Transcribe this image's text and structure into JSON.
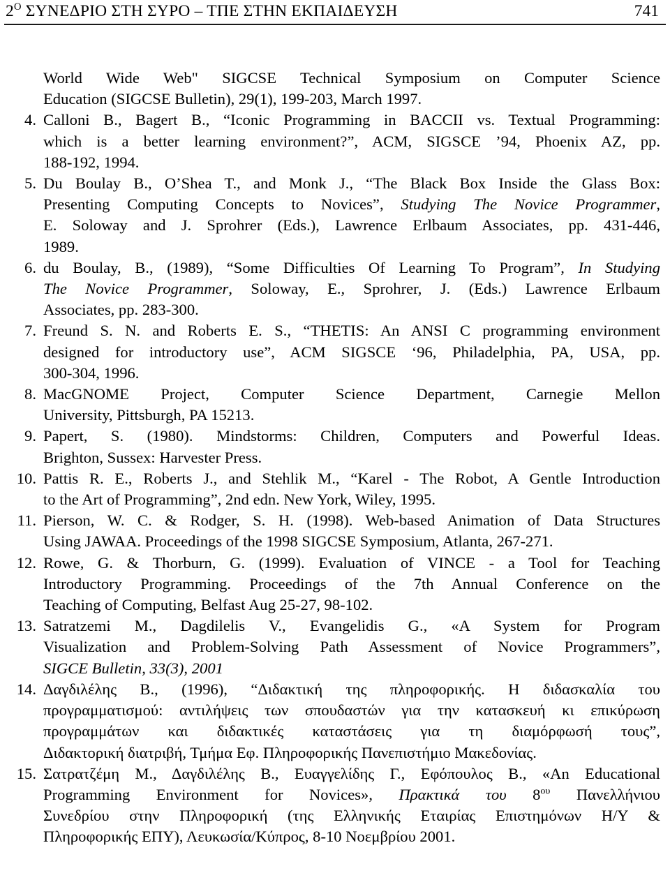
{
  "header": {
    "title_main": "2",
    "title_sup": "Ο",
    "title_rest": " ΣΥΝΕΔΡΙΟ ΣΤΗ ΣΥΡΟ – ΤΠΕ ΣΤΗΝ ΕΚΠΑΙΔΕΥΣΗ",
    "page_number": "741"
  },
  "references": [
    {
      "number": "",
      "continuation": true,
      "lines": [
        {
          "text": "World Wide Web\" SIGCSE Technical Symposium on Computer Science",
          "justified": true
        },
        {
          "text": "Education (SIGCSE Bulletin), 29(1), 199-203, March 1997.",
          "justified": false
        }
      ]
    },
    {
      "number": "4.",
      "continuation": false,
      "lines": [
        {
          "text": "Calloni B., Bagert B., “Iconic Programming in BACCII vs. Textual Programming:",
          "justified": true
        },
        {
          "text": "which is a better learning environment?”, ACM, SIGSCE ’94, Phoenix AZ, pp.",
          "justified": true
        },
        {
          "text": "188-192, 1994.",
          "justified": false
        }
      ]
    },
    {
      "number": "5.",
      "continuation": false,
      "lines": [
        {
          "text": "Du Boulay B., O’Shea T., and Monk J., “The Black Box Inside the Glass Box:",
          "justified": true
        },
        {
          "text": "Presenting Computing Concepts to Novices”, |i|Studying The Novice Programmer|/i|,",
          "justified": true
        },
        {
          "text": "E. Soloway and J. Sprohrer (Eds.), Lawrence Erlbaum Associates, pp. 431-446,",
          "justified": true
        },
        {
          "text": "1989.",
          "justified": false
        }
      ]
    },
    {
      "number": "6.",
      "continuation": false,
      "lines": [
        {
          "text": "du Boulay, B., (1989), “Some Difficulties Of Learning To Program”, |i|In Studying|/i|",
          "justified": true
        },
        {
          "text": "|i|The Novice Programmer|/i|, Soloway, E., Sprohrer, J. (Eds.) Lawrence Erlbaum",
          "justified": true
        },
        {
          "text": "Associates, pp. 283-300.",
          "justified": false
        }
      ]
    },
    {
      "number": "7.",
      "continuation": false,
      "lines": [
        {
          "text": "Freund S. N. and Roberts E. S., “THETIS: An ANSI C programming environment",
          "justified": true
        },
        {
          "text": "designed for introductory use”, ACM SIGSCE ‘96, Philadelphia, PA, USA, pp.",
          "justified": true
        },
        {
          "text": "300-304, 1996.",
          "justified": false
        }
      ]
    },
    {
      "number": "8.",
      "continuation": false,
      "lines": [
        {
          "text": "MacGNOME Project, Computer Science Department, Carnegie Mellon",
          "justified": true
        },
        {
          "text": "University, Pittsburgh, PA 15213.",
          "justified": false
        }
      ]
    },
    {
      "number": "9.",
      "continuation": false,
      "lines": [
        {
          "text": "Papert, S. (1980). Mindstorms: Children, Computers and Powerful Ideas.",
          "justified": true
        },
        {
          "text": "Brighton, Sussex: Harvester Press.",
          "justified": false
        }
      ]
    },
    {
      "number": "10.",
      "continuation": false,
      "lines": [
        {
          "text": "Pattis R. E., Roberts J., and Stehlik M., “Karel - The Robot, A Gentle Introduction",
          "justified": true
        },
        {
          "text": "to the Art of Programming”, 2nd edn. New York, Wiley, 1995.",
          "justified": false
        }
      ]
    },
    {
      "number": "11.",
      "continuation": false,
      "lines": [
        {
          "text": "Pierson, W. C. & Rodger, S. H. (1998). Web-based Animation of Data Structures",
          "justified": true
        },
        {
          "text": "Using JAWAA. Proceedings of the 1998 SIGCSE Symposium, Atlanta, 267-271.",
          "justified": false
        }
      ]
    },
    {
      "number": "12.",
      "continuation": false,
      "lines": [
        {
          "text": "Rowe, G. & Thorburn, G. (1999). Evaluation of VINCE - a Tool for Teaching",
          "justified": true
        },
        {
          "text": "Introductory Programming. Proceedings of the 7th Annual Conference on the",
          "justified": true
        },
        {
          "text": "Teaching of Computing, Belfast Aug 25-27, 98-102.",
          "justified": false
        }
      ]
    },
    {
      "number": "13.",
      "continuation": false,
      "lines": [
        {
          "text": "Satratzemi M., Dagdilelis V., Evangelidis G., «A System for Program",
          "justified": true
        },
        {
          "text": "Visualization and Problem-Solving Path Assessment of Novice Programmers”,",
          "justified": true
        },
        {
          "text": "|i|SIGCE Bulletin, 33(3), 2001|/i|",
          "justified": false
        }
      ]
    },
    {
      "number": "14.",
      "continuation": false,
      "lines": [
        {
          "text": "Δαγδιλέλης Β., (1996), “Διδακτική της πληροφορικής. Η διδασκαλία του",
          "justified": true
        },
        {
          "text": "προγραμματισμού: αντιλήψεις των σπουδαστών για την κατασκευή κι επικύρωση",
          "justified": true
        },
        {
          "text": "προγραμμάτων και διδακτικές καταστάσεις για τη διαμόρφωσή τους”,",
          "justified": true
        },
        {
          "text": "Διδακτορική διατριβή, Τμήμα Εφ. Πληροφορικής Πανεπιστήμιο Μακεδονίας.",
          "justified": false
        }
      ]
    },
    {
      "number": "15.",
      "continuation": false,
      "lines": [
        {
          "text": "Σατρατζέμη Μ., Δαγδιλέλης Β., Ευαγγελίδης Γ., Εφόπουλος Β., «An Educational",
          "justified": true
        },
        {
          "text": "Programming Environment for Novices», |i|Πρακτικά του|/i| 8|sup|ου|/sup| Πανελλήνιου",
          "justified": true
        },
        {
          "text": "Συνεδρίου στην Πληροφορική (της Ελληνικής Εταιρίας Επιστημόνων Η/Υ &",
          "justified": true
        },
        {
          "text": "Πληροφορικής ΕΠΥ), Λευκωσία/Κύπρος, 8-10 Νοεμβρίου 2001.",
          "justified": false
        }
      ]
    }
  ]
}
